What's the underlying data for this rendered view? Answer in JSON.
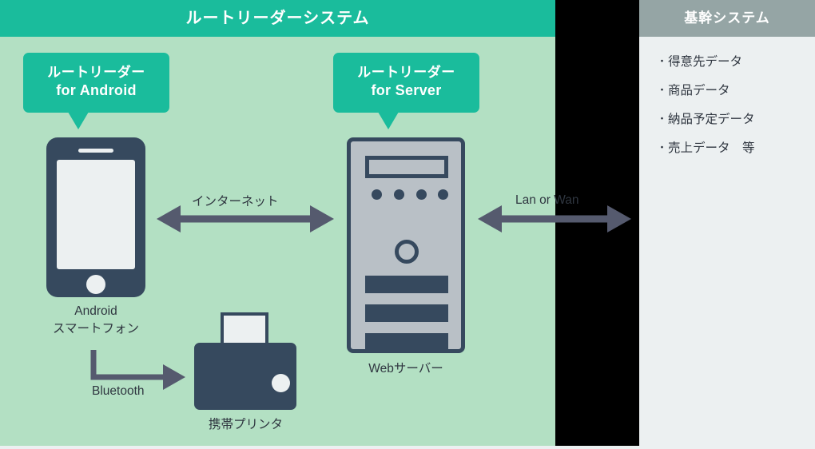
{
  "theme": {
    "header_teal": "#1abc9c",
    "body_mint": "#b3e0c3",
    "divider_black": "#000000",
    "right_header_gray": "#95a5a5",
    "right_body_gray": "#ecf0f1",
    "device_navy": "#36495e",
    "arrow_slate": "#555a6e",
    "text_dark": "#2f3640"
  },
  "left_panel": {
    "title": "ルートリーダーシステム",
    "callouts": [
      {
        "line1": "ルートリーダー",
        "line2": "for Android"
      },
      {
        "line1": "ルートリーダー",
        "line2": "for Server"
      }
    ],
    "devices": [
      {
        "name": "android-smartphone",
        "label_line1": "Android",
        "label_line2": "スマートフォン"
      },
      {
        "name": "mobile-printer",
        "label": "携帯プリンタ"
      },
      {
        "name": "web-server",
        "label": "Webサーバー"
      }
    ],
    "connections": [
      {
        "name": "internet",
        "label": "インターネット",
        "style": "double-arrow"
      },
      {
        "name": "bluetooth",
        "label": "Bluetooth",
        "style": "elbow-arrow"
      },
      {
        "name": "lan-or-wan",
        "label": "Lan or Wan",
        "style": "double-arrow"
      }
    ]
  },
  "right_panel": {
    "title": "基幹システム",
    "bullets": [
      "得意先データ",
      "商品データ",
      "納品予定データ",
      "売上データ　等"
    ]
  }
}
